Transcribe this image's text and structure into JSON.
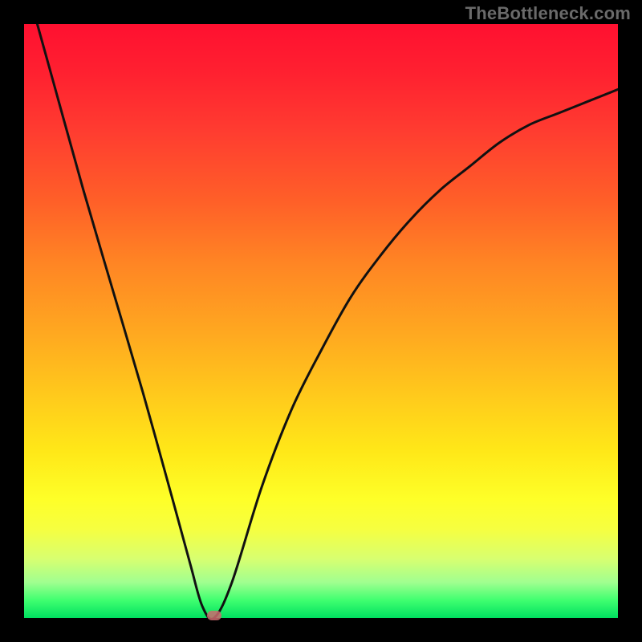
{
  "watermark": "TheBottleneck.com",
  "colors": {
    "frame": "#000000",
    "curve_stroke": "#111111",
    "marker": "#cc6a6e",
    "gradient_top": "#ff1030",
    "gradient_bottom": "#00e060"
  },
  "chart_data": {
    "type": "line",
    "title": "",
    "xlabel": "",
    "ylabel": "",
    "xlim": [
      0,
      100
    ],
    "ylim": [
      0,
      100
    ],
    "grid": false,
    "legend": false,
    "series": [
      {
        "name": "bottleneck-curve",
        "x": [
          0,
          5,
          10,
          15,
          20,
          25,
          28,
          30,
          32,
          35,
          40,
          45,
          50,
          55,
          60,
          65,
          70,
          75,
          80,
          85,
          90,
          95,
          100
        ],
        "y": [
          108,
          90,
          72,
          55,
          38,
          20,
          9,
          2,
          0,
          6,
          22,
          35,
          45,
          54,
          61,
          67,
          72,
          76,
          80,
          83,
          85,
          87,
          89
        ]
      }
    ],
    "annotations": [
      {
        "name": "minimum-marker",
        "x": 32,
        "y": 0
      }
    ],
    "background": "vertical-gradient red-to-green"
  }
}
